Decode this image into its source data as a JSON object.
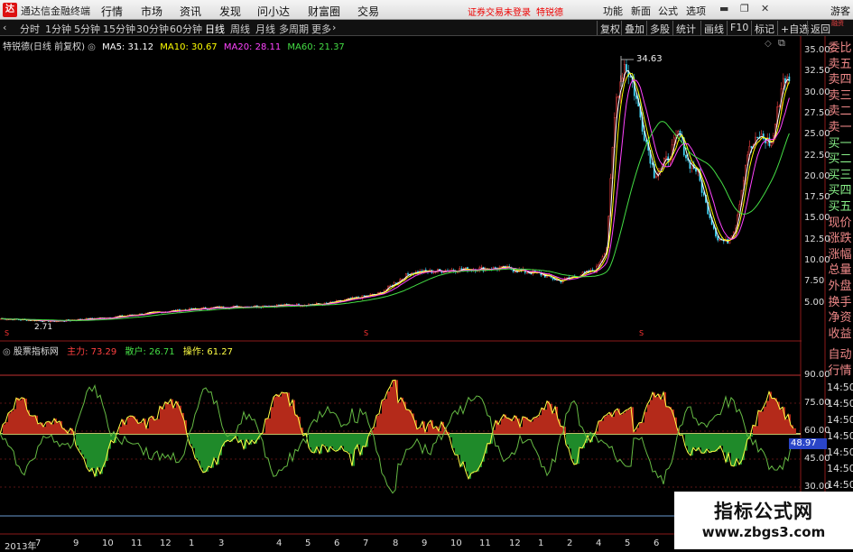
{
  "app": {
    "title": "通达信金融终端",
    "logo": "达"
  },
  "menu": [
    "行情",
    "市场",
    "资讯",
    "发现",
    "问小达",
    "财富圈",
    "交易"
  ],
  "notice": [
    "证券交易未登录",
    "特锐德"
  ],
  "right_menu": [
    "功能",
    "新面",
    "公式",
    "选项"
  ],
  "window_buttons": [
    "▬",
    "❐",
    "✕"
  ],
  "guest_label": "游客",
  "periods": [
    "分时",
    "1分钟",
    "5分钟",
    "15分钟",
    "30分钟",
    "60分钟",
    "日线",
    "周线",
    "月线",
    "多周期",
    "更多"
  ],
  "active_period": "日线",
  "toolbar_right": [
    "复权",
    "叠加",
    "多股",
    "统计",
    "画线",
    "F10",
    "标记",
    "+自选",
    "返回"
  ],
  "main_chart": {
    "stock_label": "特锐德(日线 前复权)",
    "ma": [
      {
        "label": "MA5: 31.12",
        "color": "#ffffff"
      },
      {
        "label": "MA10: 30.67",
        "color": "#ffff00"
      },
      {
        "label": "MA20: 28.11",
        "color": "#ff44ff"
      },
      {
        "label": "MA60: 21.37",
        "color": "#44dd44"
      }
    ],
    "high_label": "34.63",
    "low_label": "2.71",
    "right_ticks": [
      "35.00",
      "32.50",
      "30.00",
      "27.50",
      "25.00",
      "22.50",
      "20.00",
      "17.50",
      "15.00",
      "12.50",
      "10.00",
      "7.50",
      "5.00"
    ],
    "side_labels": [
      "委比",
      "卖五",
      "卖四",
      "卖三",
      "卖二",
      "卖一",
      "买一",
      "买二",
      "买三",
      "买四",
      "买五",
      "现价",
      "涨跌",
      "涨幅",
      "总量",
      "外盘",
      "换手",
      "净资",
      "收益"
    ],
    "corner_label": "融资"
  },
  "indicator": {
    "name": "股票指标网",
    "items": [
      {
        "label": "主力: 73.29",
        "color": "#ff4040"
      },
      {
        "label": "散户: 26.71",
        "color": "#44dd44"
      },
      {
        "label": "操作: 61.27",
        "color": "#ffff44"
      }
    ],
    "ticks": [
      "90.00",
      "75.00",
      "60.00",
      "45.00",
      "30.00"
    ],
    "current": "48.97",
    "side_labels": [
      "自动",
      "行情",
      "14:50",
      "14:50",
      "14:50",
      "14:50",
      "14:50",
      "14:50",
      "14:50"
    ]
  },
  "x_axis": [
    "2013年",
    "7",
    "9",
    "10",
    "11",
    "12",
    "1",
    "3",
    "4",
    "5",
    "6",
    "7",
    "8",
    "9",
    "10",
    "11",
    "12",
    "1",
    "2",
    "4",
    "5",
    "6",
    "7"
  ],
  "watermark": {
    "line1": "指标公式网",
    "line2": "www.zbgs3.com"
  }
}
